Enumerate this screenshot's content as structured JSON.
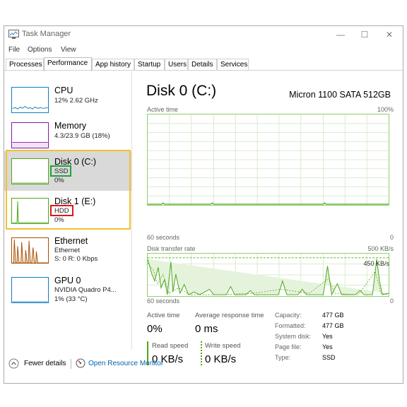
{
  "window": {
    "title": "Task Manager"
  },
  "menu": [
    "File",
    "Options",
    "View"
  ],
  "tabs": [
    "Processes",
    "Performance",
    "App history",
    "Startup",
    "Users",
    "Details",
    "Services"
  ],
  "active_tab": "Performance",
  "sidebar": {
    "cpu": {
      "name": "CPU",
      "sub": "12% 2.62 GHz"
    },
    "memory": {
      "name": "Memory",
      "sub": "4.3/23.9 GB (18%)"
    },
    "disk0": {
      "name": "Disk 0 (C:)",
      "type": "SSD",
      "usage": "0%"
    },
    "disk1": {
      "name": "Disk 1 (E:)",
      "type": "HDD",
      "usage": "0%"
    },
    "ethernet": {
      "name": "Ethernet",
      "sub1": "Ethernet",
      "sub2": "S: 0 R: 0 Kbps"
    },
    "gpu": {
      "name": "GPU 0",
      "sub1": "NVIDIA Quadro P4...",
      "sub2": "1% (33 °C)"
    }
  },
  "main": {
    "title": "Disk 0 (C:)",
    "model": "Micron 1100 SATA 512GB",
    "graph1": {
      "label": "Active time",
      "max": "100%",
      "time": "60 seconds",
      "min": "0"
    },
    "graph2": {
      "label": "Disk transfer rate",
      "max": "500 KB/s",
      "inner": "450 KB/s",
      "time": "60 seconds",
      "min": "0"
    },
    "stats": {
      "active_time_label": "Active time",
      "active_time": "0%",
      "response_label": "Average response time",
      "response": "0 ms",
      "read_label": "Read speed",
      "read": "0 KB/s",
      "write_label": "Write speed",
      "write": "0 KB/s"
    },
    "props": {
      "capacity_k": "Capacity:",
      "capacity": "477 GB",
      "formatted_k": "Formatted:",
      "formatted": "477 GB",
      "system_k": "System disk:",
      "system": "Yes",
      "pagefile_k": "Page file:",
      "pagefile": "Yes",
      "type_k": "Type:",
      "type": "SSD"
    }
  },
  "footer": {
    "fewer": "Fewer details",
    "monitor": "Open Resource Monitor"
  },
  "colors": {
    "disk_green": "#4da61a",
    "cpu_blue": "#117dbb",
    "mem_purple": "#8b12ae",
    "eth_orange": "#a74f01",
    "annotation_yellow": "#f2c12e",
    "ssd_box": "#1ca53a",
    "hdd_box": "#e0161b"
  }
}
